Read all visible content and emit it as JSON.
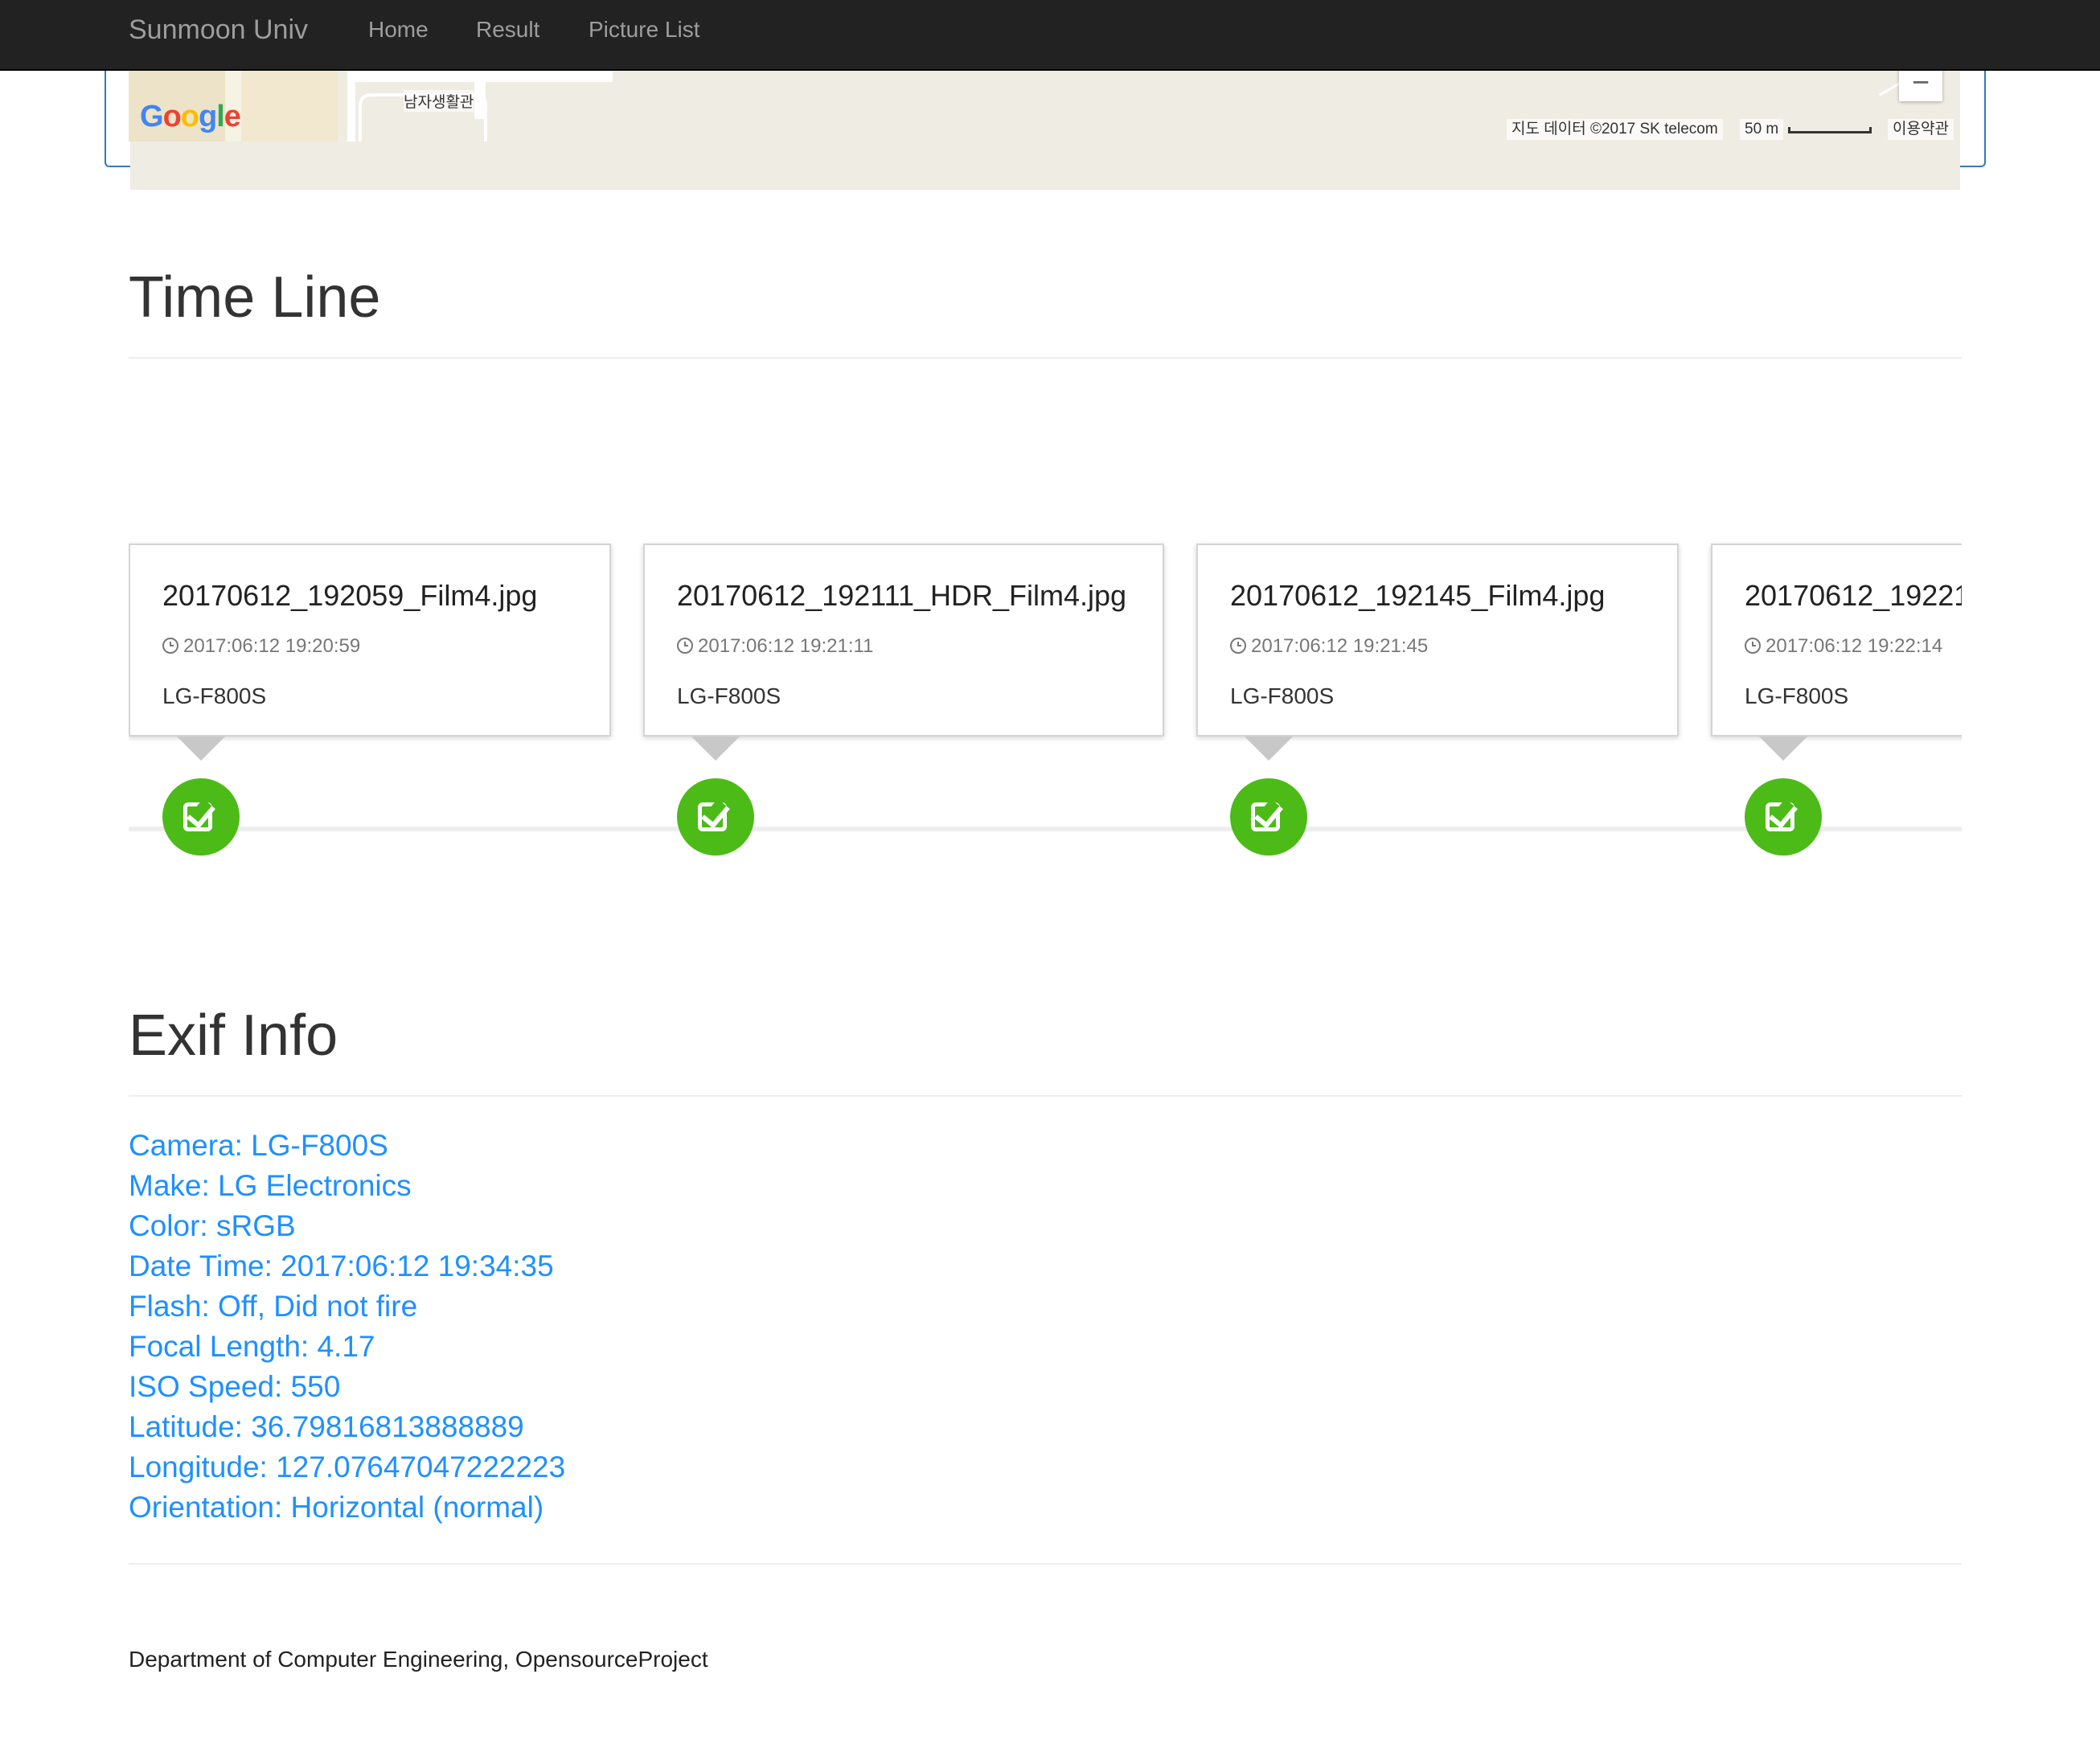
{
  "navbar": {
    "brand": "Sunmoon Univ",
    "links": [
      "Home",
      "Result",
      "Picture List"
    ]
  },
  "map": {
    "logo_letters": [
      "G",
      "o",
      "o",
      "g",
      "l",
      "e"
    ],
    "logo_colors": [
      "#4285f4",
      "#ea4335",
      "#fbbc05",
      "#4285f4",
      "#34a853",
      "#ea4335"
    ],
    "place_label": "남자생활관",
    "attribution": "지도 데이터 ©2017 SK telecom",
    "scale_label": "50 m",
    "terms_label": "이용약관",
    "zoom_out_label": "−"
  },
  "timeline": {
    "title": "Time Line",
    "events": [
      {
        "filename": "20170612_192059_Film4.jpg",
        "datetime": "2017:06:12 19:20:59",
        "camera": "LG-F800S"
      },
      {
        "filename": "20170612_192111_HDR_Film4.jpg",
        "datetime": "2017:06:12 19:21:11",
        "camera": "LG-F800S"
      },
      {
        "filename": "20170612_192145_Film4.jpg",
        "datetime": "2017:06:12 19:21:45",
        "camera": "LG-F800S"
      },
      {
        "filename": "20170612_19221",
        "datetime": "2017:06:12 19:22:14",
        "camera": "LG-F800S"
      }
    ],
    "badge_color": "#4cbb17"
  },
  "exif": {
    "title": "Exif Info",
    "items": [
      "Camera: LG-F800S",
      "Make: LG Electronics",
      "Color: sRGB",
      "Date Time: 2017:06:12 19:34:35",
      "Flash: Off, Did not fire",
      "Focal Length: 4.17",
      "ISO Speed: 550",
      "Latitude: 36.79816813888889",
      "Longitude: 127.07647047222223",
      "Orientation: Horizontal (normal)"
    ],
    "link_color": "#1e90ff"
  },
  "footer": {
    "text": "Department of Computer Engineering, OpensourceProject"
  }
}
